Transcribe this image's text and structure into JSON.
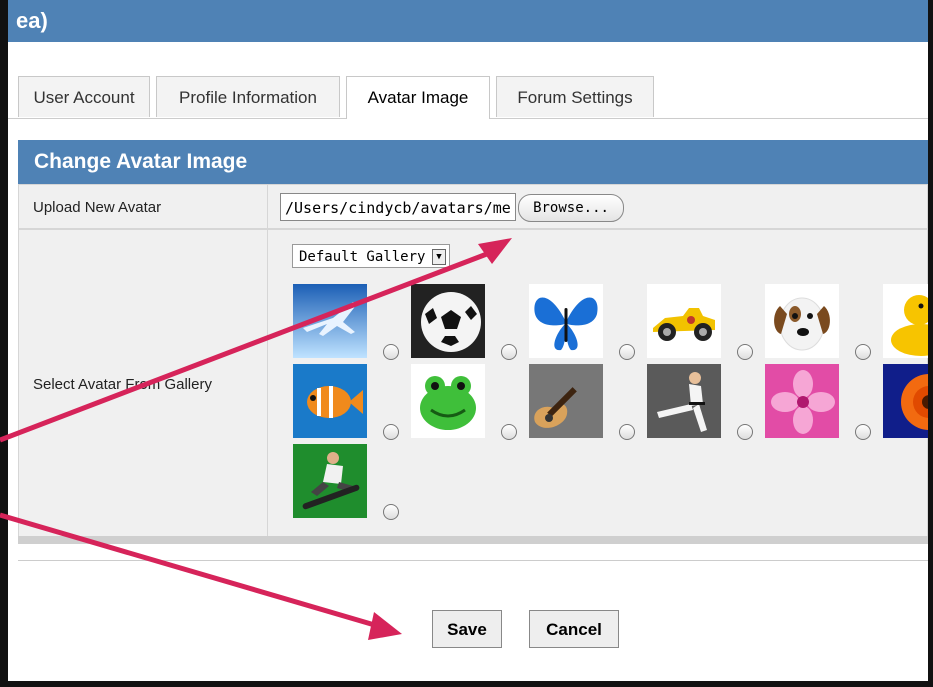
{
  "header": {
    "title": "ea)"
  },
  "tabs": [
    {
      "label": "User Account"
    },
    {
      "label": "Profile Information"
    },
    {
      "label": "Avatar Image",
      "active": true
    },
    {
      "label": "Forum Settings"
    }
  ],
  "section": {
    "title": "Change Avatar Image"
  },
  "upload": {
    "label": "Upload New Avatar",
    "file_value": "/Users/cindycb/avatars/me",
    "browse_label": "Browse..."
  },
  "gallery": {
    "label": "Select Avatar From Gallery",
    "select_value": "Default Gallery",
    "avatars": [
      {
        "name": "airplane"
      },
      {
        "name": "soccer-ball"
      },
      {
        "name": "butterfly"
      },
      {
        "name": "race-car"
      },
      {
        "name": "dog"
      },
      {
        "name": "rubber-duck"
      },
      {
        "name": "fish"
      },
      {
        "name": "frog"
      },
      {
        "name": "guitar"
      },
      {
        "name": "karate"
      },
      {
        "name": "flower-pink"
      },
      {
        "name": "flower-orange"
      },
      {
        "name": "skateboarder"
      }
    ]
  },
  "actions": {
    "save_label": "Save",
    "cancel_label": "Cancel"
  },
  "colors": {
    "header_blue": "#4f82b5",
    "arrow_red": "#d6245a"
  }
}
